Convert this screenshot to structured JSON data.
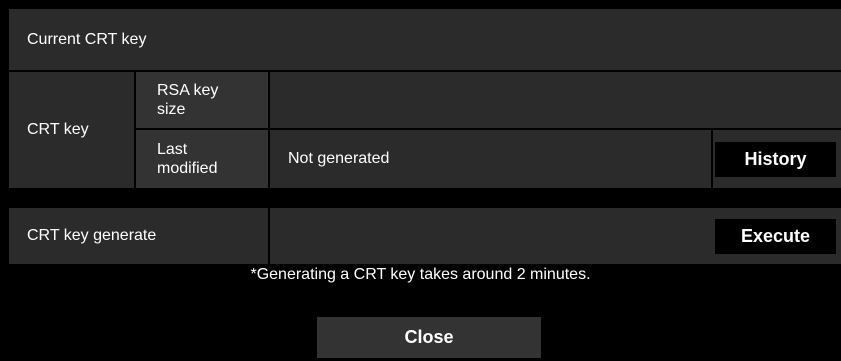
{
  "section_title": "Current CRT key",
  "crt_key": {
    "label": "CRT key",
    "rsa_key_size_label": "RSA key size",
    "rsa_key_size_value": "",
    "last_modified_label": "Last modified",
    "last_modified_value": "Not generated",
    "history_button": "History"
  },
  "generate": {
    "label": "CRT key generate",
    "execute_button": "Execute"
  },
  "note": "*Generating a CRT key takes around 2 minutes.",
  "close_button": "Close"
}
